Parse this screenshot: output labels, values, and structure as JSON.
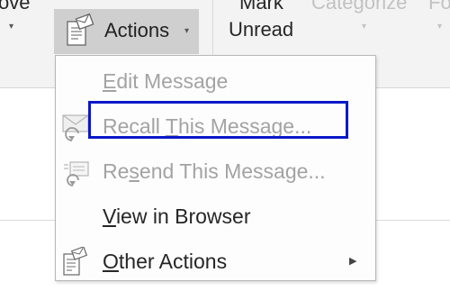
{
  "ribbon": {
    "move_partial": "ove",
    "actions_label": "Actions",
    "mark_label": "Mark",
    "unread_label": "Unread",
    "categorize_partial": "Categorize",
    "follow_partial": "Fo"
  },
  "menu": {
    "items": [
      {
        "label_pre": "",
        "label_mnemonic": "E",
        "label_post": "dit Message",
        "enabled": false
      },
      {
        "label_pre": "Recall ",
        "label_mnemonic": "T",
        "label_post": "his Message...",
        "enabled": false,
        "highlighted": true
      },
      {
        "label_pre": "Re",
        "label_mnemonic": "s",
        "label_post": "end This Message...",
        "enabled": false
      },
      {
        "label_pre": "",
        "label_mnemonic": "V",
        "label_post": "iew in Browser",
        "enabled": true
      },
      {
        "label_pre": "",
        "label_mnemonic": "O",
        "label_post": "ther Actions",
        "enabled": true,
        "has_submenu": true
      }
    ]
  },
  "colors": {
    "highlight_border": "#0a18c8",
    "disabled_text": "#a3a3a3",
    "ribbon_bg": "#f3f3f3",
    "button_pressed": "#cfcfcf"
  }
}
